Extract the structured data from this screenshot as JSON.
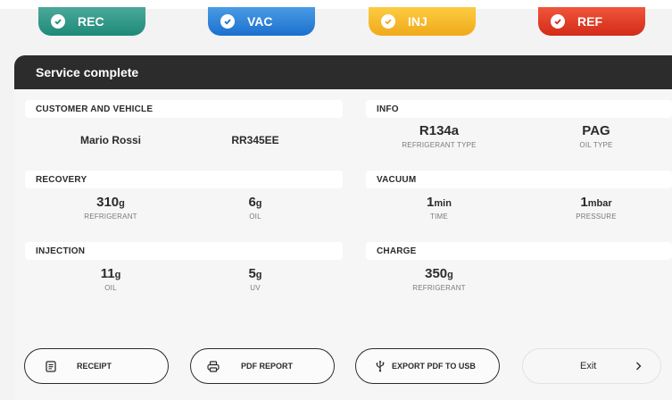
{
  "tabs": [
    {
      "label": "REC",
      "color": "#1e8a78"
    },
    {
      "label": "VAC",
      "color": "#1b70cf"
    },
    {
      "label": "INJ",
      "color": "#f1a91b"
    },
    {
      "label": "REF",
      "color": "#d32b18"
    }
  ],
  "title": "Service complete",
  "customer": {
    "section": "CUSTOMER AND VEHICLE",
    "name": "Mario Rossi",
    "plate": "RR345EE"
  },
  "info": {
    "section": "INFO",
    "refrigerant": {
      "value": "R134a",
      "label": "REFRIGERANT TYPE"
    },
    "oil": {
      "value": "PAG",
      "label": "OIL TYPE"
    }
  },
  "recovery": {
    "section": "RECOVERY",
    "refrigerant": {
      "value": "310",
      "unit": "g",
      "label": "REFRIGERANT"
    },
    "oil": {
      "value": "6",
      "unit": "g",
      "label": "OIL"
    }
  },
  "vacuum": {
    "section": "VACUUM",
    "time": {
      "value": "1",
      "unit": "min",
      "label": "TIME"
    },
    "pressure": {
      "value": "1",
      "unit": "mbar",
      "label": "PRESSURE"
    }
  },
  "injection": {
    "section": "INJECTION",
    "oil": {
      "value": "11",
      "unit": "g",
      "label": "OIL"
    },
    "uv": {
      "value": "5",
      "unit": "g",
      "label": "UV"
    }
  },
  "charge": {
    "section": "CHARGE",
    "refrigerant": {
      "value": "350",
      "unit": "g",
      "label": "REFRIGERANT"
    }
  },
  "buttons": {
    "receipt": "RECEIPT",
    "pdf_report": "PDF REPORT",
    "export_usb": "EXPORT PDF TO USB",
    "exit": "Exit"
  }
}
